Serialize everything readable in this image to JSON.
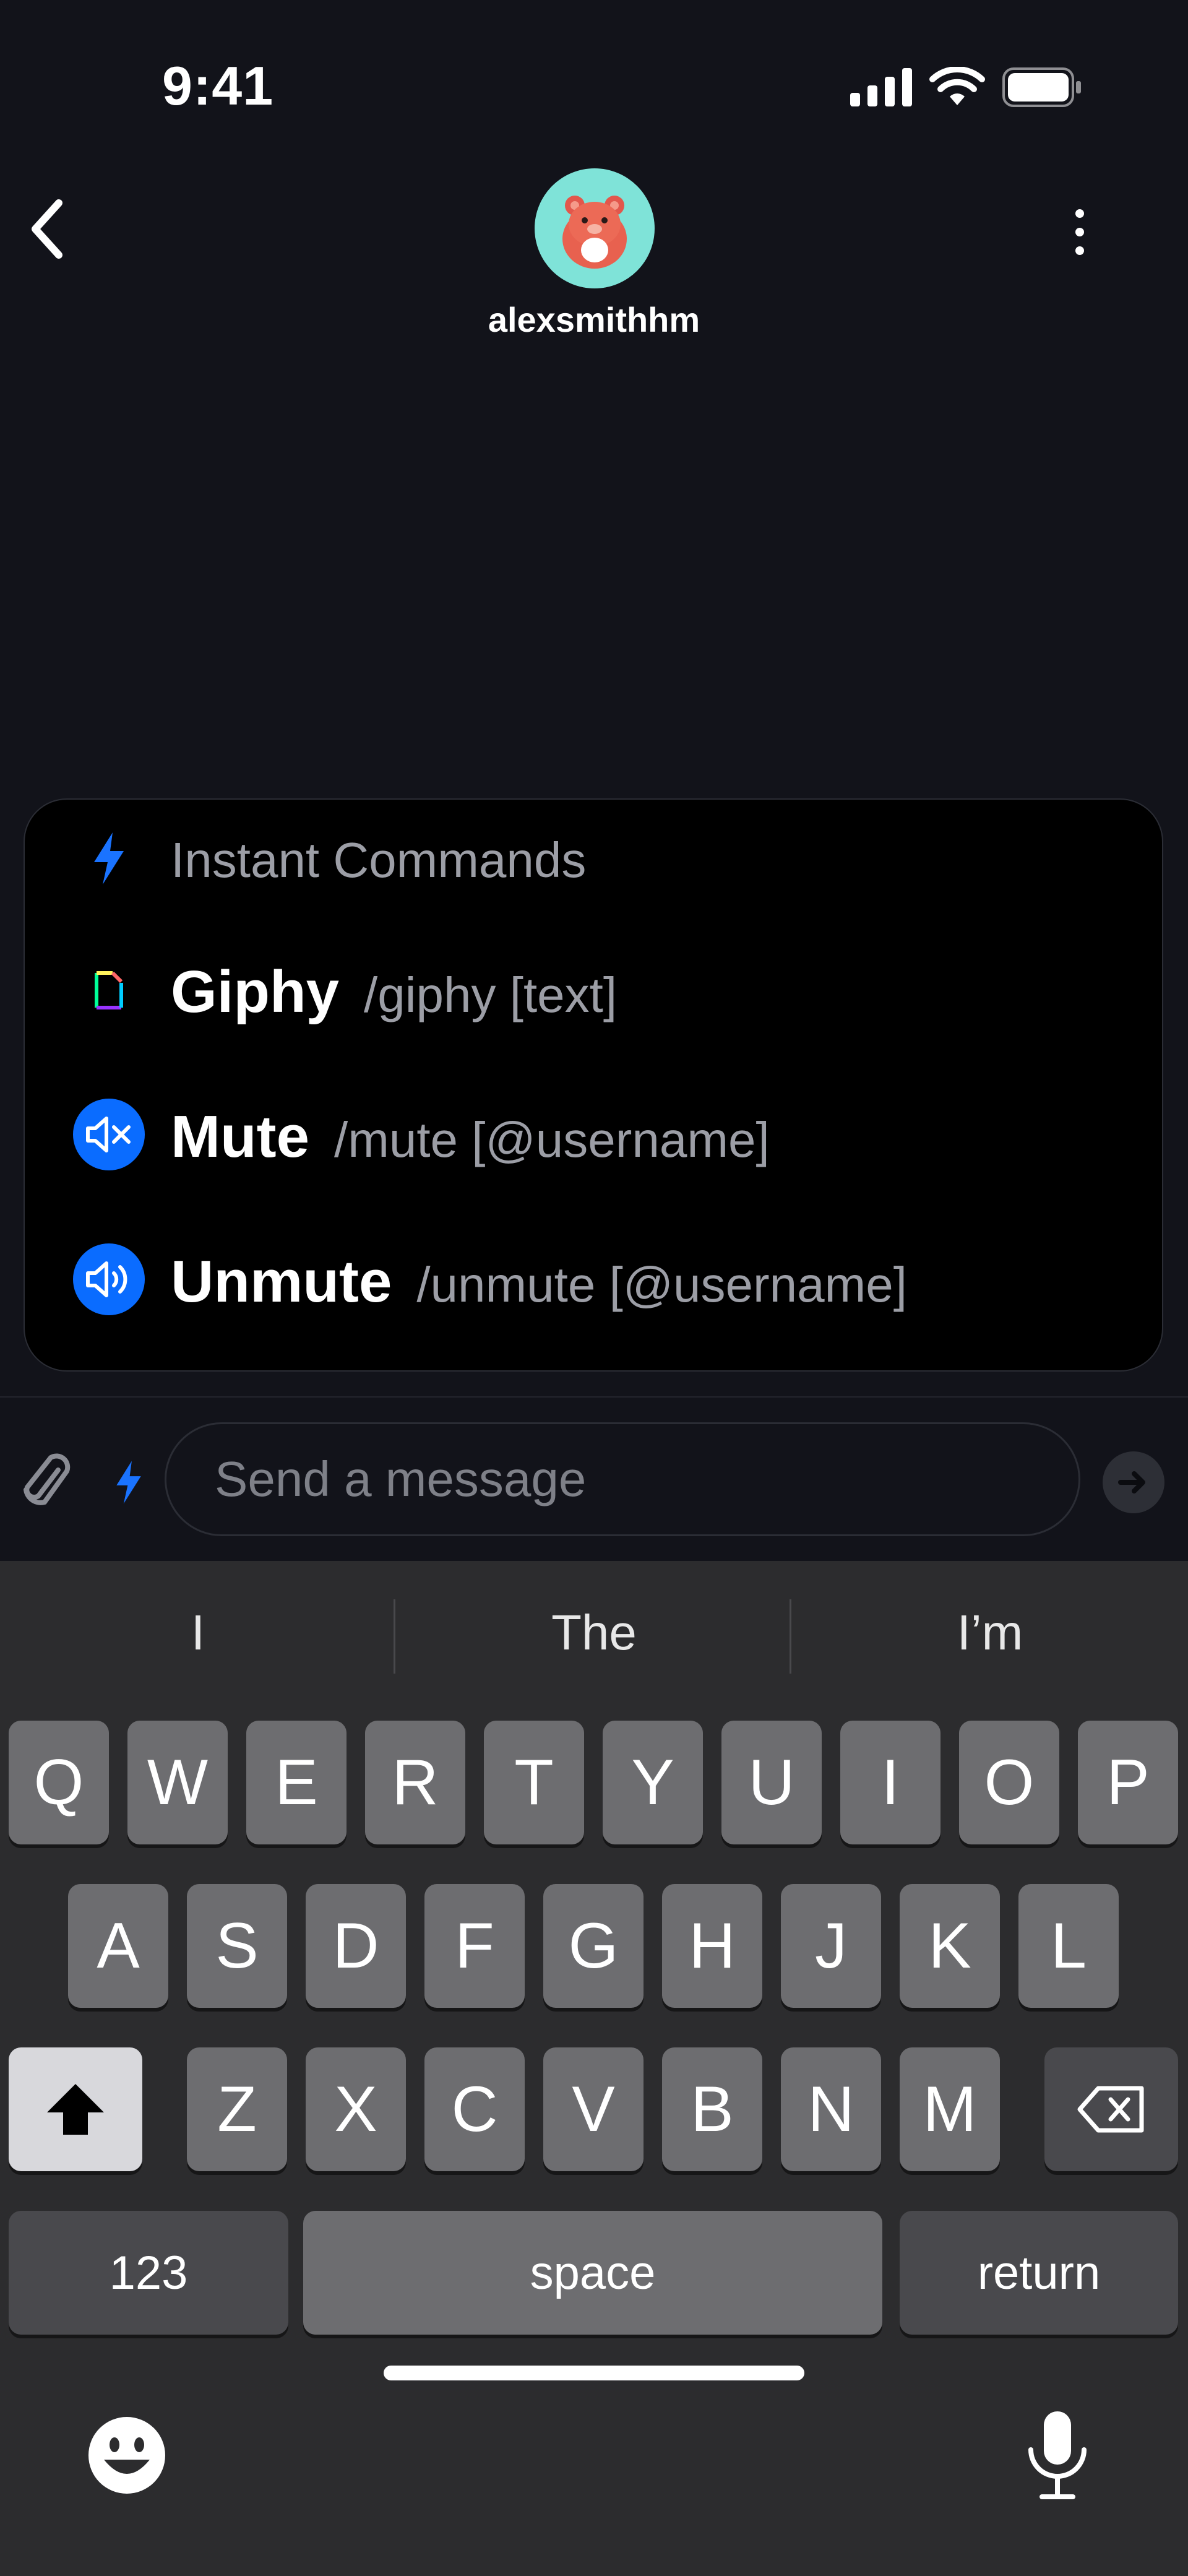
{
  "status_bar": {
    "time": "9:41"
  },
  "header": {
    "username": "alexsmithhm"
  },
  "commands": {
    "title": "Instant Commands",
    "items": [
      {
        "name": "Giphy",
        "args": "/giphy [text]",
        "icon": "giphy-icon"
      },
      {
        "name": "Mute",
        "args": "/mute [@username]",
        "icon": "mute-icon"
      },
      {
        "name": "Unmute",
        "args": "/unmute [@username]",
        "icon": "unmute-icon"
      }
    ]
  },
  "composer": {
    "placeholder": "Send a message"
  },
  "keyboard": {
    "suggestions": [
      "I",
      "The",
      "I’m"
    ],
    "row1": [
      "Q",
      "W",
      "E",
      "R",
      "T",
      "Y",
      "U",
      "I",
      "O",
      "P"
    ],
    "row2": [
      "A",
      "S",
      "D",
      "F",
      "G",
      "H",
      "J",
      "K",
      "L"
    ],
    "row3": [
      "Z",
      "X",
      "C",
      "V",
      "B",
      "N",
      "M"
    ],
    "numbers_label": "123",
    "space_label": "space",
    "return_label": "return"
  },
  "colors": {
    "accent": "#0a6cff",
    "avatar_bg": "#7fe3d8",
    "background": "#12131a"
  }
}
